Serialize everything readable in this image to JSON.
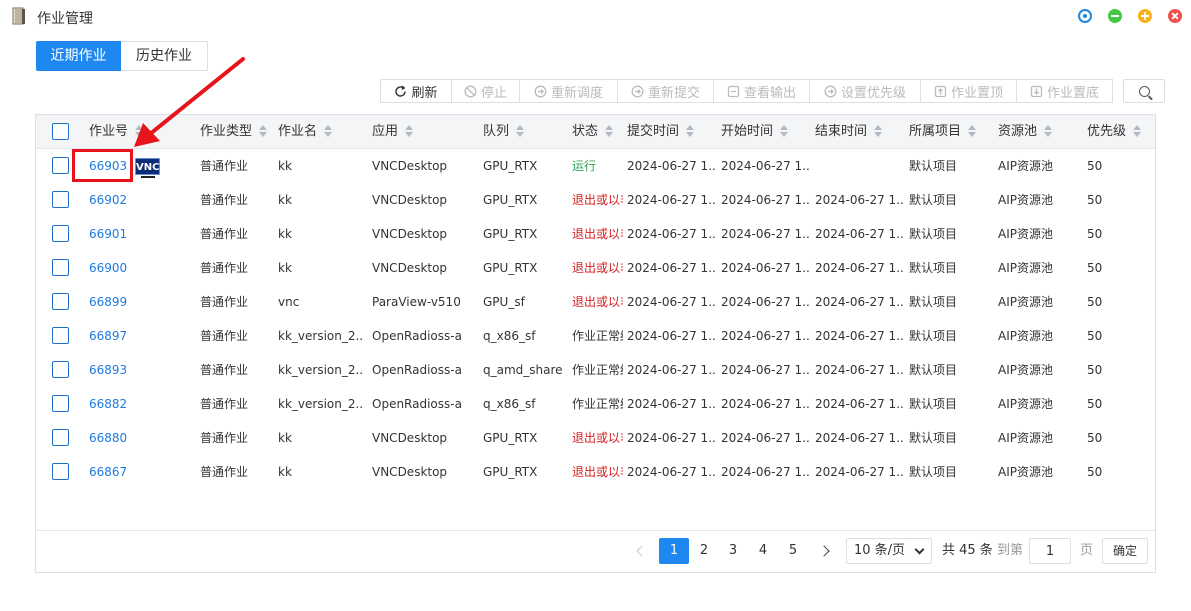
{
  "window": {
    "title": "作业管理"
  },
  "tabs": [
    {
      "label": "近期作业",
      "active": true
    },
    {
      "label": "历史作业",
      "active": false
    }
  ],
  "toolbar": [
    {
      "label": "刷新",
      "icon": "refresh-icon",
      "enabled": true
    },
    {
      "label": "停止",
      "icon": "stop-icon",
      "enabled": false
    },
    {
      "label": "重新调度",
      "icon": "reschedule-icon",
      "enabled": false
    },
    {
      "label": "重新提交",
      "icon": "resubmit-icon",
      "enabled": false
    },
    {
      "label": "查看输出",
      "icon": "output-icon",
      "enabled": false
    },
    {
      "label": "设置优先级",
      "icon": "priority-icon",
      "enabled": false
    },
    {
      "label": "作业置顶",
      "icon": "pin-top-icon",
      "enabled": false
    },
    {
      "label": "作业置底",
      "icon": "pin-bottom-icon",
      "enabled": false
    }
  ],
  "table": {
    "columns": [
      "作业号",
      "作业类型",
      "作业名",
      "应用",
      "队列",
      "状态",
      "提交时间",
      "开始时间",
      "结束时间",
      "所属项目",
      "资源池",
      "优先级"
    ],
    "rows": [
      {
        "id": "66903",
        "type": "普通作业",
        "name": "kk",
        "app": "VNCDesktop",
        "queue": "GPU_RTX",
        "status": "运行",
        "status_kind": "run",
        "submit": "2024-06-27 1...",
        "start": "2024-06-27 1...",
        "end": "",
        "project": "默认项目",
        "pool": "AIP资源池",
        "priority": "50",
        "vnc": "VNC"
      },
      {
        "id": "66902",
        "type": "普通作业",
        "name": "kk",
        "app": "VNCDesktop",
        "queue": "GPU_RTX",
        "status": "退出或以非",
        "status_kind": "exit",
        "submit": "2024-06-27 1...",
        "start": "2024-06-27 1...",
        "end": "2024-06-27 1...",
        "project": "默认项目",
        "pool": "AIP资源池",
        "priority": "50"
      },
      {
        "id": "66901",
        "type": "普通作业",
        "name": "kk",
        "app": "VNCDesktop",
        "queue": "GPU_RTX",
        "status": "退出或以非",
        "status_kind": "exit",
        "submit": "2024-06-27 1...",
        "start": "2024-06-27 1...",
        "end": "2024-06-27 1...",
        "project": "默认项目",
        "pool": "AIP资源池",
        "priority": "50"
      },
      {
        "id": "66900",
        "type": "普通作业",
        "name": "kk",
        "app": "VNCDesktop",
        "queue": "GPU_RTX",
        "status": "退出或以非",
        "status_kind": "exit",
        "submit": "2024-06-27 1...",
        "start": "2024-06-27 1...",
        "end": "2024-06-27 1...",
        "project": "默认项目",
        "pool": "AIP资源池",
        "priority": "50"
      },
      {
        "id": "66899",
        "type": "普通作业",
        "name": "vnc",
        "app": "ParaView-v510",
        "queue": "GPU_sf",
        "status": "退出或以非",
        "status_kind": "exit",
        "submit": "2024-06-27 1...",
        "start": "2024-06-27 1...",
        "end": "2024-06-27 1...",
        "project": "默认项目",
        "pool": "AIP资源池",
        "priority": "50"
      },
      {
        "id": "66897",
        "type": "普通作业",
        "name": "kk_version_2...",
        "app": "OpenRadioss-a",
        "queue": "q_x86_sf",
        "status": "作业正常结",
        "status_kind": "ok",
        "submit": "2024-06-27 1...",
        "start": "2024-06-27 1...",
        "end": "2024-06-27 1...",
        "project": "默认项目",
        "pool": "AIP资源池",
        "priority": "50"
      },
      {
        "id": "66893",
        "type": "普通作业",
        "name": "kk_version_2...",
        "app": "OpenRadioss-a",
        "queue": "q_amd_share",
        "status": "作业正常结",
        "status_kind": "ok",
        "submit": "2024-06-27 1...",
        "start": "2024-06-27 1...",
        "end": "2024-06-27 1...",
        "project": "默认项目",
        "pool": "AIP资源池",
        "priority": "50"
      },
      {
        "id": "66882",
        "type": "普通作业",
        "name": "kk_version_2...",
        "app": "OpenRadioss-a",
        "queue": "q_x86_sf",
        "status": "作业正常结",
        "status_kind": "ok",
        "submit": "2024-06-27 1...",
        "start": "2024-06-27 1...",
        "end": "2024-06-27 1...",
        "project": "默认项目",
        "pool": "AIP资源池",
        "priority": "50"
      },
      {
        "id": "66880",
        "type": "普通作业",
        "name": "kk",
        "app": "VNCDesktop",
        "queue": "GPU_RTX",
        "status": "退出或以非",
        "status_kind": "exit",
        "submit": "2024-06-27 1...",
        "start": "2024-06-27 1...",
        "end": "2024-06-27 1...",
        "project": "默认项目",
        "pool": "AIP资源池",
        "priority": "50"
      },
      {
        "id": "66867",
        "type": "普通作业",
        "name": "kk",
        "app": "VNCDesktop",
        "queue": "GPU_RTX",
        "status": "退出或以非",
        "status_kind": "exit",
        "submit": "2024-06-27 1...",
        "start": "2024-06-27 1...",
        "end": "2024-06-27 1...",
        "project": "默认项目",
        "pool": "AIP资源池",
        "priority": "50"
      }
    ]
  },
  "pagination": {
    "pages": [
      "1",
      "2",
      "3",
      "4",
      "5"
    ],
    "current": "1",
    "page_size": "10 条/页",
    "total_text": "共 45 条",
    "goto_label": "到第",
    "goto_value": "1",
    "page_unit": "页",
    "confirm_label": "确定"
  },
  "colors": {
    "primary": "#1e88f0",
    "link": "#1e7be0",
    "running": "#2fa84f",
    "exited": "#d42020",
    "annotation": "#e8141c"
  }
}
